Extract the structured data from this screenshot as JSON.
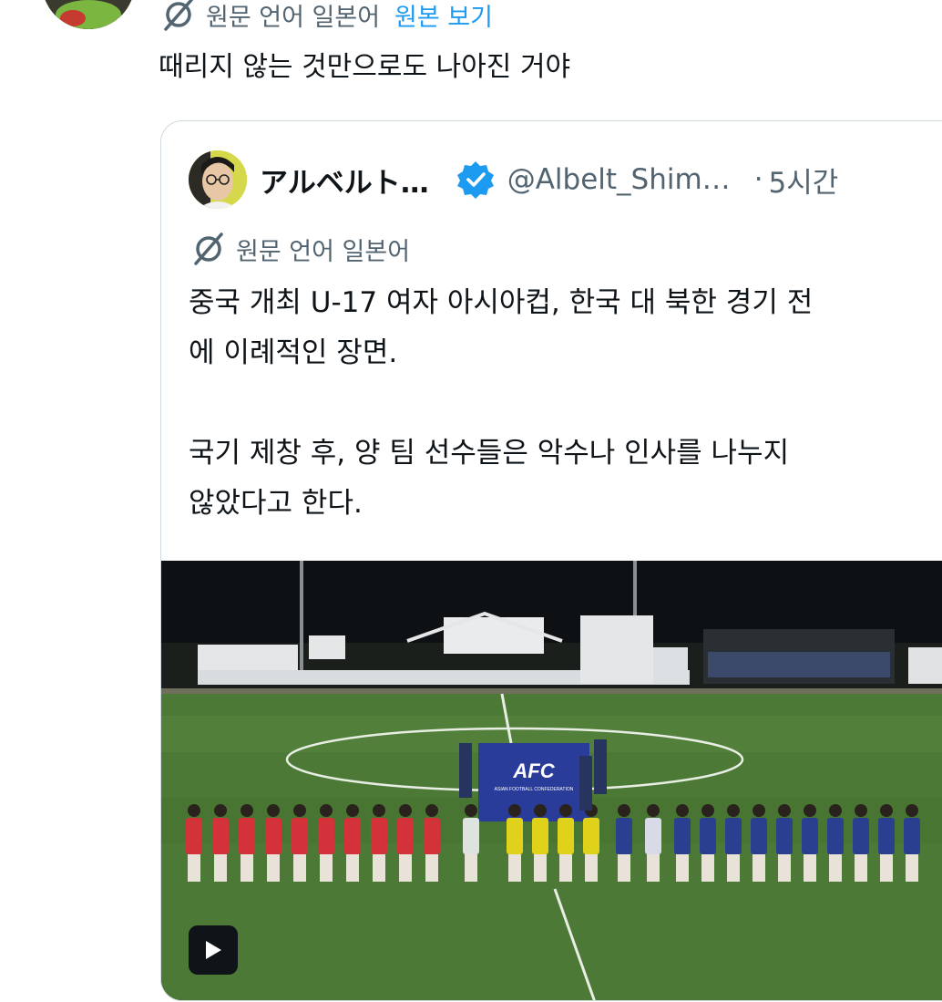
{
  "reply": {
    "translation_label": "원문 언어 일본어",
    "view_original_link": "원본 보기",
    "text": "때리지 않는 것만으로도 나아진 거야"
  },
  "quoted_tweet": {
    "author_name": "アルベルト…",
    "handle": "@Albelt_Shim…",
    "separator": "·",
    "time": "5시간",
    "translation_label": "원문 언어 일본어",
    "body": "중국 개최 U-17 여자 아시아컵, 한국 대 북한 경기 전\n에 이례적인 장면.\n\n국기 제창 후, 양 팀 선수들은 악수나 인사를 나누지\n않았다고 한다.",
    "media": {
      "banner_text": "AFC",
      "banner_subtext": "ASIAN FOOTBALL CONFEDERATION",
      "play_icon": "play-icon"
    }
  },
  "colors": {
    "link": "#1d9bf0",
    "secondary_text": "#536471",
    "border": "#cfd9de",
    "verified": "#1d9bf0"
  }
}
